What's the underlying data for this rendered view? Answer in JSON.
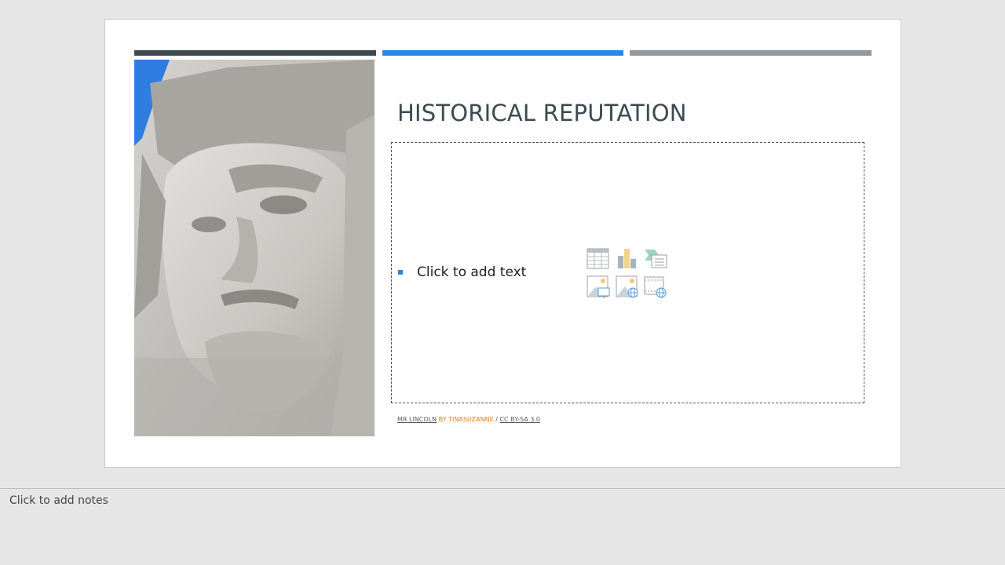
{
  "slide": {
    "title": "HISTORICAL REPUTATION",
    "placeholder": {
      "bullet_text": "Click to add text",
      "insert_icons": [
        {
          "name": "insert-table-icon",
          "icon": "table-icon"
        },
        {
          "name": "insert-chart-icon",
          "icon": "chart-icon"
        },
        {
          "name": "insert-smartart-icon",
          "icon": "smartart-icon"
        },
        {
          "name": "insert-picture-icon",
          "icon": "picture-icon"
        },
        {
          "name": "insert-online-picture-icon",
          "icon": "online-picture-icon"
        },
        {
          "name": "insert-video-icon",
          "icon": "video-icon"
        }
      ]
    },
    "credit": {
      "title_link": "MR LINCOLN",
      "by_author": " BY TINASUZANNE ",
      "separator": "/ ",
      "license_link": "CC BY-SA 3.0"
    },
    "accent_colors": {
      "dark": "#3d4a4f",
      "blue": "#2e86de",
      "gray": "#929a9e",
      "orange": "#e07a1f"
    },
    "image": {
      "subject": "stone-carved-face-photo"
    }
  },
  "notes": {
    "placeholder": "Click to add notes"
  }
}
